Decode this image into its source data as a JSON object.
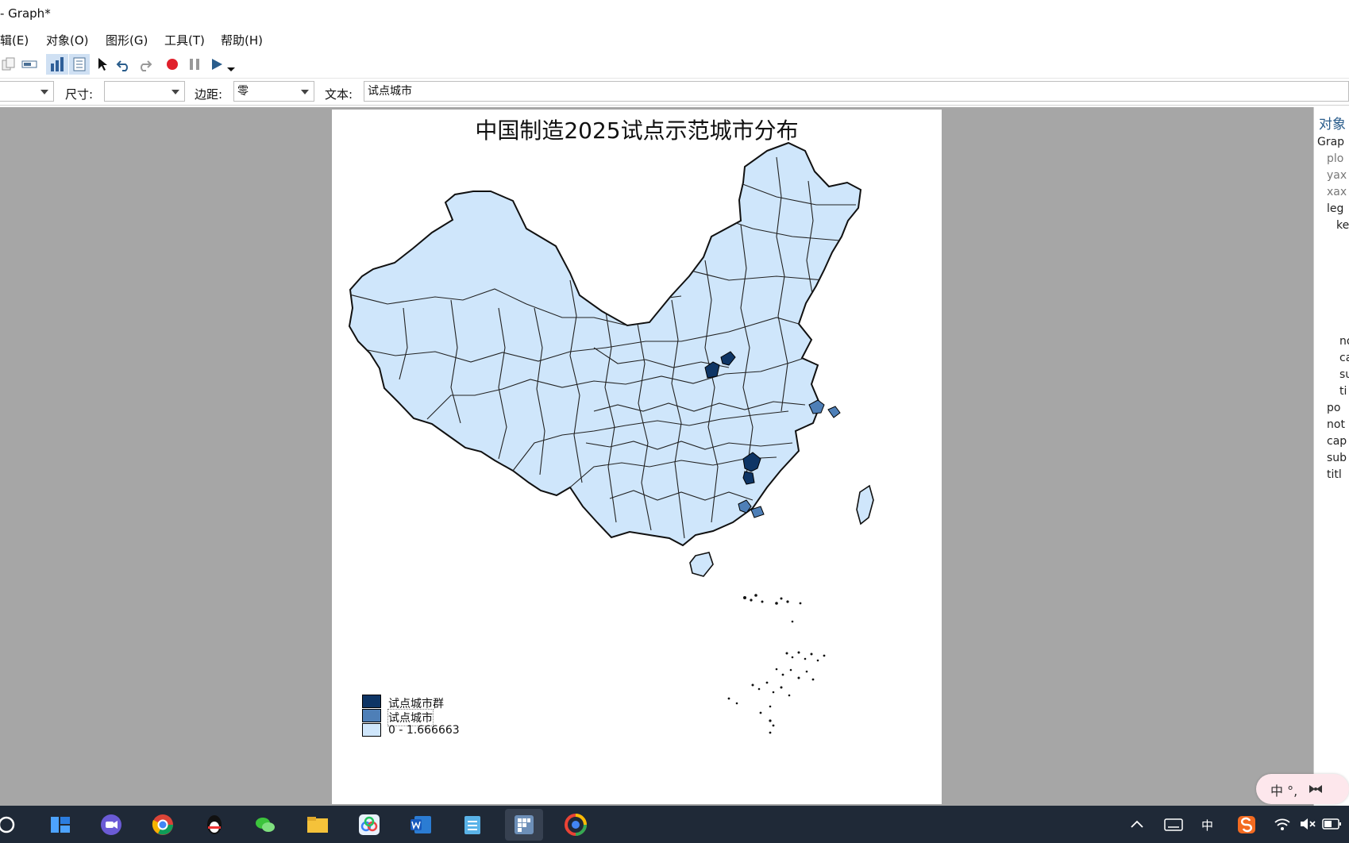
{
  "window": {
    "title": "- Graph*"
  },
  "menu": [
    "辑(E)",
    "对象(O)",
    "图形(G)",
    "工具(T)",
    "帮助(H)"
  ],
  "props": {
    "size_label": "尺寸:",
    "margin_label": "边距:",
    "margin_value": "零",
    "text_label": "文本:",
    "text_value": "试点城市"
  },
  "graph": {
    "title": "中国制造2025试点示范城市分布",
    "legend": [
      {
        "label": "试点城市群",
        "color": "#0e3565"
      },
      {
        "label": "试点城市",
        "color": "#4e7fb7"
      },
      {
        "label": "0 - 1.666663",
        "color": "#cfe6fb"
      }
    ]
  },
  "object_panel": {
    "title": "对象",
    "items": [
      "Grap",
      "plo",
      "yax",
      "xax",
      "leg",
      "ke",
      "no",
      "ca",
      "su",
      "ti",
      "po",
      "not",
      "cap",
      "sub",
      "titl"
    ]
  },
  "taskbar": {
    "ime_char": "中"
  },
  "ime": {
    "label": "中 °,",
    "icon": "bow-icon"
  }
}
